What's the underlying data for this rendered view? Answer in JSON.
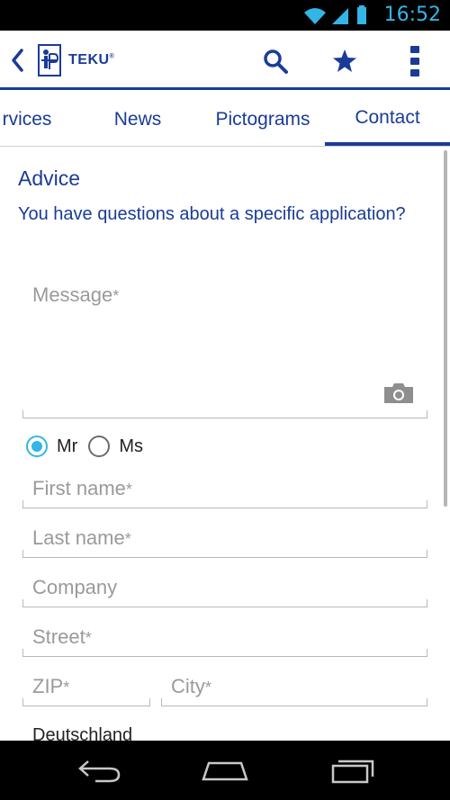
{
  "status_bar": {
    "time": "16:52",
    "icons": [
      "wifi-icon",
      "signal-icon",
      "battery-icon"
    ]
  },
  "action_bar": {
    "logo_text": "TEKU",
    "logo_mark": "®",
    "actions": [
      "search-icon",
      "star-icon",
      "overflow-menu-icon"
    ]
  },
  "tabs": [
    {
      "label": "rvices",
      "active": false
    },
    {
      "label": "News",
      "active": false
    },
    {
      "label": "Pictograms",
      "active": false
    },
    {
      "label": "Contact",
      "active": true
    }
  ],
  "form": {
    "heading": "Advice",
    "subheading": "You have questions about a specific application?",
    "message_placeholder": "Message",
    "required_mark": "*",
    "salutation_options": [
      {
        "label": "Mr",
        "checked": true
      },
      {
        "label": "Ms",
        "checked": false
      }
    ],
    "first_name_placeholder": "First name",
    "last_name_placeholder": "Last name",
    "company_placeholder": "Company",
    "street_placeholder": "Street",
    "zip_placeholder": "ZIP",
    "city_placeholder": "City",
    "country_value": "Deutschland"
  },
  "colors": {
    "brand": "#1a3c96",
    "accent": "#33b5e5"
  }
}
